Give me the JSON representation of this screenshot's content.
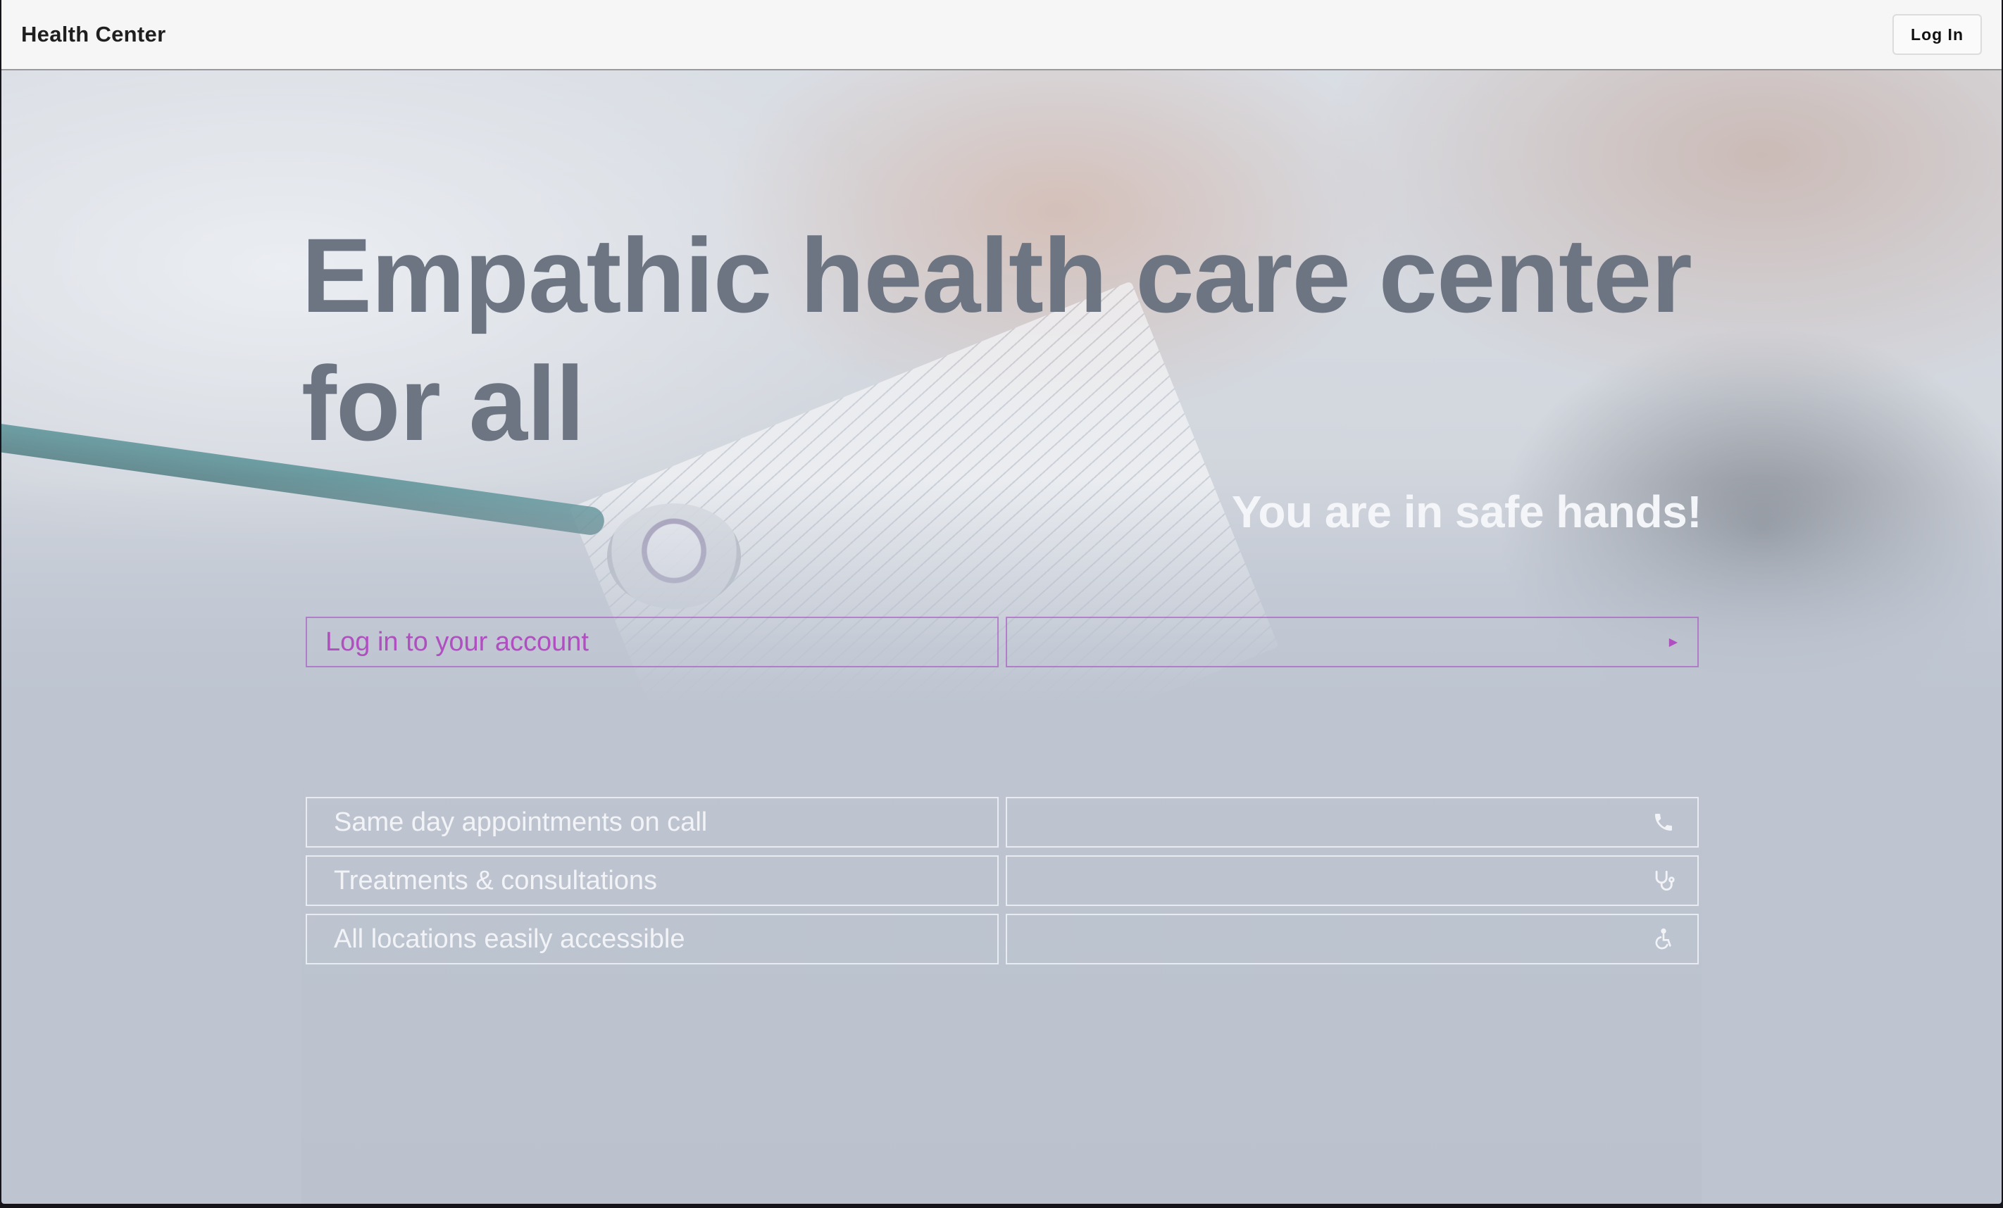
{
  "header": {
    "brand": "Health Center",
    "login_label": "Log In"
  },
  "hero": {
    "headline": "Empathic health care center for all",
    "tagline": "You are in safe hands!"
  },
  "login_row": {
    "label": "Log in to your account",
    "icon": "chevron-right-icon"
  },
  "features": [
    {
      "label": "Same day appointments on call",
      "icon": "phone-icon"
    },
    {
      "label": "Treatments & consultations",
      "icon": "stethoscope-icon"
    },
    {
      "label": "All locations easily accessible",
      "icon": "accessibility-icon"
    }
  ],
  "colors": {
    "accent": "#b04fc0",
    "headline": "#6d7583",
    "background": "#bec5d1"
  }
}
